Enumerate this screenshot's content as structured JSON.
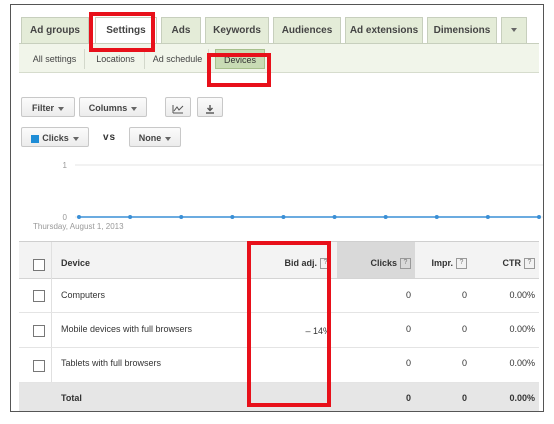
{
  "tabs": [
    "Ad groups",
    "Settings",
    "Ads",
    "Keywords",
    "Audiences",
    "Ad extensions",
    "Dimensions"
  ],
  "subtabs": [
    "All settings",
    "Locations",
    "Ad schedule",
    "Devices"
  ],
  "toolbar": {
    "filter_label": "Filter",
    "columns_label": "Columns"
  },
  "metric_selector": {
    "primary": "Clicks",
    "vs_label": "vs",
    "secondary": "None",
    "primary_color": "#1f8dd6"
  },
  "chart_data": {
    "type": "line",
    "x": [
      "Thursday, August 1, 2013"
    ],
    "series": [
      {
        "name": "Clicks",
        "values": [
          0,
          0,
          0,
          0,
          0,
          0,
          0,
          0,
          0,
          0
        ]
      }
    ],
    "ylim": [
      0,
      1
    ],
    "yticks": [
      "1",
      "0"
    ],
    "start_label": "Thursday, August 1, 2013",
    "color": "#3a8fd6"
  },
  "table": {
    "headers": {
      "device": "Device",
      "bid_adj": "Bid adj.",
      "clicks": "Clicks",
      "impr": "Impr.",
      "ctr": "CTR"
    },
    "help_glyph": "?",
    "rows": [
      {
        "device": "Computers",
        "bid_adj": "",
        "clicks": "0",
        "impr": "0",
        "ctr": "0.00%"
      },
      {
        "device": "Mobile devices with full browsers",
        "bid_adj": "– 14%",
        "clicks": "0",
        "impr": "0",
        "ctr": "0.00%"
      },
      {
        "device": "Tablets with full browsers",
        "bid_adj": "",
        "clicks": "0",
        "impr": "0",
        "ctr": "0.00%"
      }
    ],
    "total": {
      "label": "Total",
      "clicks": "0",
      "impr": "0",
      "ctr": "0.00%"
    }
  },
  "highlight_color": "#e8101a"
}
